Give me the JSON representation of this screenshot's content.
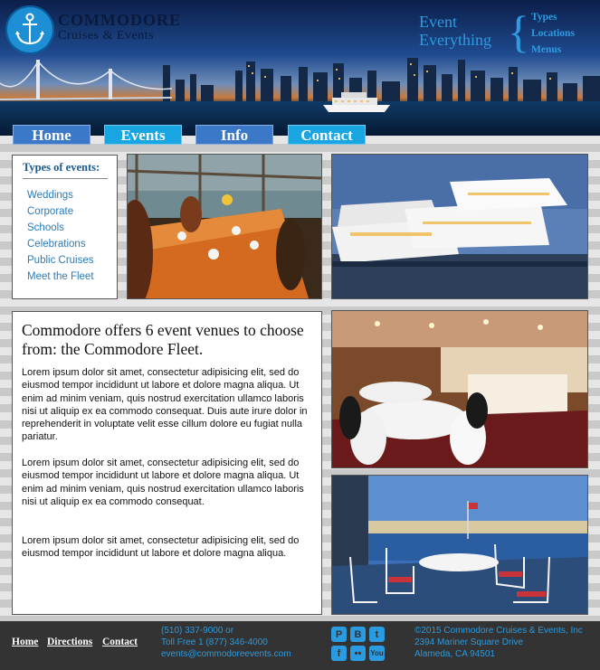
{
  "brand": {
    "name": "COMMODORE",
    "subtitle": "Cruises & Events"
  },
  "tagline": {
    "line1": "Event",
    "line2": "Everything"
  },
  "top_menu": [
    "Types",
    "Locations",
    "Menus"
  ],
  "nav": {
    "home": "Home",
    "events": "Events",
    "info": "Info",
    "contact": "Contact"
  },
  "sidebar": {
    "title": "Types of events:",
    "items": [
      "Weddings",
      "Corporate",
      "Schools",
      "Celebrations",
      "Public Cruises",
      "Meet the Fleet"
    ]
  },
  "main": {
    "heading": "Commodore offers 6 event venues to choose from: the Commodore Fleet.",
    "paragraphs": [
      "Lorem ipsum dolor sit amet, consectetur adipisicing elit, sed do eiusmod tempor incididunt ut labore et dolore magna aliqua. Ut enim ad minim veniam, quis nostrud exercitation ullamco laboris nisi ut aliquip ex ea commodo consequat. Duis aute irure dolor in reprehenderit in voluptate velit esse cillum dolore eu fugiat nulla pariatur.",
      "Lorem ipsum dolor sit amet, consectetur adipisicing elit, sed do eiusmod tempor incididunt ut labore et dolore magna aliqua. Ut enim ad minim veniam, quis nostrud exercitation ullamco laboris nisi ut aliquip ex ea commodo consequat.",
      "Lorem ipsum dolor sit amet, consectetur adipisicing elit, sed do eiusmod tempor incididunt ut labore et dolore magna aliqua."
    ]
  },
  "footer": {
    "links": {
      "home": "Home",
      "directions": "Directions",
      "contact": "Contact"
    },
    "contact": [
      "(510) 337-9000 or",
      "Toll Free 1 (877) 346-4000",
      "events@commodoreevents.com"
    ],
    "copyright": [
      "©2015 Commodore Cruises & Events, Inc",
      "2394 Mariner Square Drive",
      "Alameda, CA 94501"
    ],
    "social": [
      "pinterest-icon",
      "blogger-icon",
      "twitter-icon",
      "facebook-icon",
      "flickr-icon",
      "youtube-icon"
    ]
  },
  "colors": {
    "accent": "#2a9be0",
    "nav_dark": "#3b78c7",
    "nav_light": "#19a4e2",
    "footer_bg": "#333333"
  }
}
